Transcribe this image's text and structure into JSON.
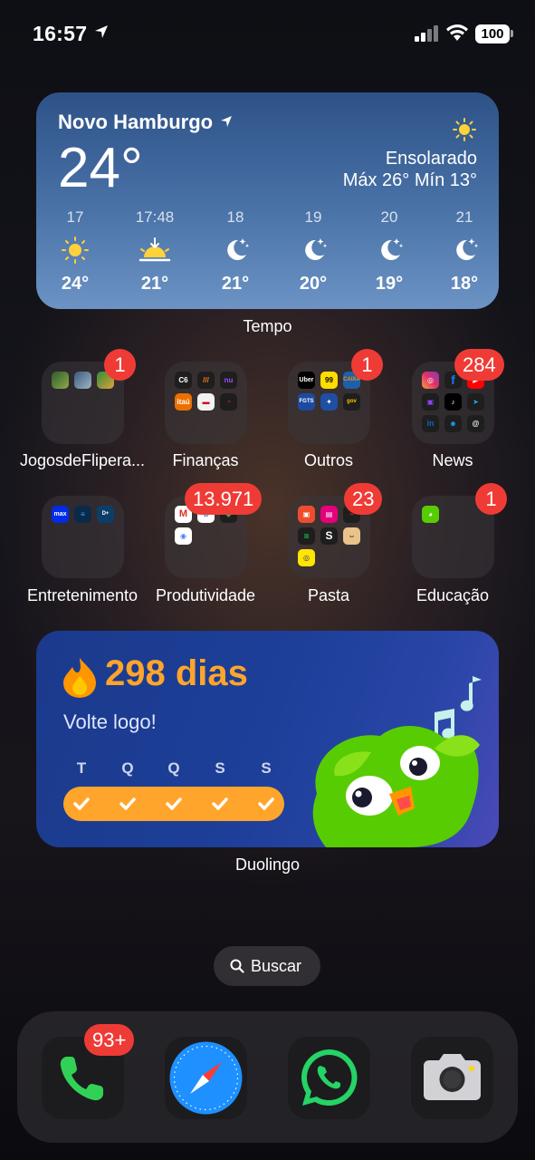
{
  "status_bar": {
    "time": "16:57",
    "battery": "100"
  },
  "weather": {
    "city": "Novo Hamburgo",
    "temperature": "24°",
    "condition": "Ensolarado",
    "range": "Máx 26° Mín 13°",
    "hours": [
      {
        "label": "17",
        "temp": "24°",
        "icon": "sun-icon"
      },
      {
        "label": "17:48",
        "temp": "21°",
        "icon": "sunset-icon"
      },
      {
        "label": "18",
        "temp": "21°",
        "icon": "moon-stars-icon"
      },
      {
        "label": "19",
        "temp": "20°",
        "icon": "moon-stars-icon"
      },
      {
        "label": "20",
        "temp": "19°",
        "icon": "moon-stars-icon"
      },
      {
        "label": "21",
        "temp": "18°",
        "icon": "moon-stars-icon"
      }
    ],
    "widget_label": "Tempo"
  },
  "folders": [
    {
      "label": "JogosdeFlipera...",
      "badge": "1"
    },
    {
      "label": "Finanças",
      "badge": ""
    },
    {
      "label": "Outros",
      "badge": "1"
    },
    {
      "label": "News",
      "badge": "284"
    },
    {
      "label": "Entretenimento",
      "badge": ""
    },
    {
      "label": "Produtividade",
      "badge": "13.971"
    },
    {
      "label": "Pasta",
      "badge": "23"
    },
    {
      "label": "Educação",
      "badge": "1"
    }
  ],
  "mini_icons": {
    "c6": "C6",
    "itau": "itaú",
    "nu": "nu",
    "uber": "Uber",
    "ninety_nine": "99",
    "caixa": "CAIXA",
    "fgts": "FGTS",
    "max": "max",
    "s_app": "S"
  },
  "duolingo": {
    "streak": "298 dias",
    "message": "Volte logo!",
    "days": [
      "T",
      "Q",
      "Q",
      "S",
      "S"
    ],
    "widget_label": "Duolingo"
  },
  "search": {
    "label": "Buscar"
  },
  "dock": {
    "phone_badge": "93+"
  },
  "colors": {
    "badge": "#ef3b36",
    "duo_orange": "#ffa52b",
    "weather_blue": "#4a73a8"
  }
}
